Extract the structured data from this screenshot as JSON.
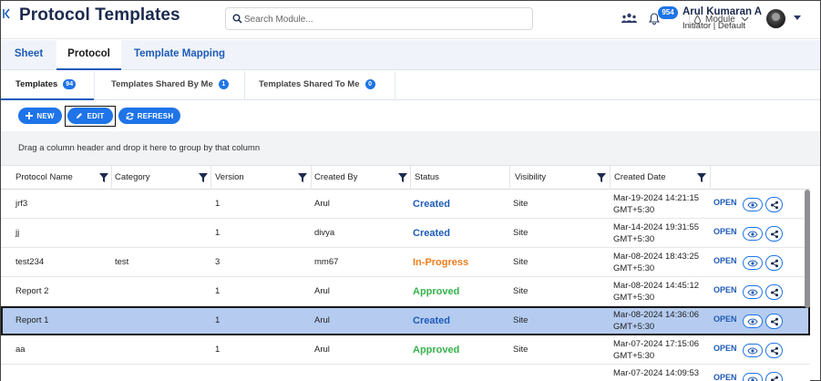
{
  "header": {
    "title": "Protocol Templates",
    "search_placeholder": "Search Module...",
    "module_label": "Module",
    "notification_count": "954",
    "user_name": "Arul Kumaran A",
    "user_role": "Initiator | Default"
  },
  "main_tabs": [
    {
      "label": "Sheet"
    },
    {
      "label": "Protocol"
    },
    {
      "label": "Template Mapping"
    }
  ],
  "sub_tabs": [
    {
      "label": "Templates",
      "count": "94"
    },
    {
      "label": "Templates Shared By Me",
      "count": "1"
    },
    {
      "label": "Templates Shared To Me",
      "count": "0"
    }
  ],
  "toolbar": {
    "new_label": "NEW",
    "edit_label": "EDIT",
    "refresh_label": "REFRESH"
  },
  "group_hint": "Drag a column header and drop it here to group by that column",
  "columns": [
    "Protocol Name",
    "Category",
    "Version",
    "Created By",
    "Status",
    "Visibility",
    "Created Date"
  ],
  "rows": [
    {
      "name": "jrf3",
      "category": "",
      "version": "1",
      "created_by": "Arul",
      "status": "Created",
      "visibility": "Site",
      "date1": "Mar-19-2024 14:21:15",
      "date2": "GMT+5:30",
      "action": "OPEN"
    },
    {
      "name": "jj",
      "category": "",
      "version": "1",
      "created_by": "divya",
      "status": "Created",
      "visibility": "Site",
      "date1": "Mar-14-2024 19:31:55",
      "date2": "GMT+5:30",
      "action": "OPEN"
    },
    {
      "name": "test234",
      "category": "test",
      "version": "3",
      "created_by": "mm67",
      "status": "In-Progress",
      "visibility": "Site",
      "date1": "Mar-08-2024 18:43:25",
      "date2": "GMT+5:30",
      "action": "OPEN"
    },
    {
      "name": "Report 2",
      "category": "",
      "version": "1",
      "created_by": "Arul",
      "status": "Approved",
      "visibility": "Site",
      "date1": "Mar-08-2024 14:45:12",
      "date2": "GMT+5:30",
      "action": "OPEN"
    },
    {
      "name": "Report 1",
      "category": "",
      "version": "1",
      "created_by": "Arul",
      "status": "Created",
      "visibility": "Site",
      "date1": "Mar-08-2024 14:36:06",
      "date2": "GMT+5:30",
      "action": "OPEN"
    },
    {
      "name": "aa",
      "category": "",
      "version": "1",
      "created_by": "Arul",
      "status": "Approved",
      "visibility": "Site",
      "date1": "Mar-07-2024 17:15:06",
      "date2": "GMT+5:30",
      "action": "OPEN"
    },
    {
      "name": "",
      "category": "",
      "version": "",
      "created_by": "",
      "status": "",
      "visibility": "",
      "date1": "Mar-07-2024 14:09:53",
      "date2": "",
      "action": "OPEN"
    }
  ],
  "selected_row": 4,
  "status_colors": {
    "Created": "#1e5bb8",
    "In-Progress": "#ef7d1c",
    "Approved": "#37b24d"
  },
  "accent_color": "#1e74e8"
}
